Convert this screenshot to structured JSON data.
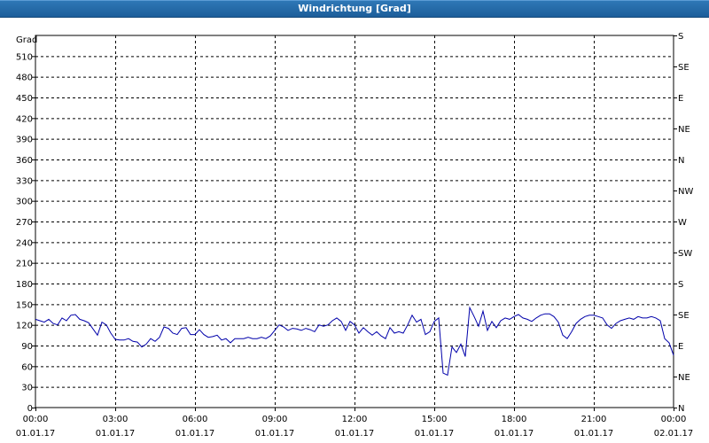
{
  "window": {
    "title": "Windrichtung [Grad]"
  },
  "colors": {
    "series": "#0000aa",
    "grid": "#000000",
    "title_bar": "#2468a8"
  },
  "chart_data": {
    "type": "line",
    "title": "Windrichtung [Grad]",
    "ylabel": "Grad",
    "xlabel": "",
    "ylim": [
      0,
      540
    ],
    "y_ticks": [
      0,
      30,
      60,
      90,
      120,
      150,
      180,
      210,
      240,
      270,
      300,
      330,
      360,
      390,
      420,
      450,
      480,
      510
    ],
    "y2_ticks": [
      {
        "value": 0,
        "label": "N"
      },
      {
        "value": 45,
        "label": "NE"
      },
      {
        "value": 90,
        "label": "E"
      },
      {
        "value": 135,
        "label": "SE"
      },
      {
        "value": 180,
        "label": "S"
      },
      {
        "value": 225,
        "label": "SW"
      },
      {
        "value": 270,
        "label": "W"
      },
      {
        "value": 315,
        "label": "NW"
      },
      {
        "value": 360,
        "label": "N"
      },
      {
        "value": 405,
        "label": "NE"
      },
      {
        "value": 450,
        "label": "E"
      },
      {
        "value": 495,
        "label": "SE"
      },
      {
        "value": 540,
        "label": "S"
      }
    ],
    "x_range": [
      "01.01.17 00:00",
      "02.01.17 00:00"
    ],
    "x_ticks": [
      {
        "time": "00:00",
        "date": "01.01.17"
      },
      {
        "time": "03:00",
        "date": "01.01.17"
      },
      {
        "time": "06:00",
        "date": "01.01.17"
      },
      {
        "time": "09:00",
        "date": "01.01.17"
      },
      {
        "time": "12:00",
        "date": "01.01.17"
      },
      {
        "time": "15:00",
        "date": "01.01.17"
      },
      {
        "time": "18:00",
        "date": "01.01.17"
      },
      {
        "time": "21:00",
        "date": "01.01.17"
      },
      {
        "time": "00:00",
        "date": "02.01.17"
      }
    ],
    "grid": true,
    "series": [
      {
        "time": [
          "00:00",
          "00:10",
          "00:20",
          "00:30",
          "00:40",
          "00:50",
          "01:00",
          "01:10",
          "01:20",
          "01:30",
          "01:40",
          "01:50",
          "02:00",
          "02:10",
          "02:20",
          "02:30",
          "02:40",
          "02:50",
          "03:00",
          "03:10",
          "03:20",
          "03:30",
          "03:40",
          "03:50",
          "04:00",
          "04:10",
          "04:20",
          "04:30",
          "04:40",
          "04:50",
          "05:00",
          "05:10",
          "05:20",
          "05:30",
          "05:40",
          "05:50",
          "06:00",
          "06:10",
          "06:20",
          "06:30",
          "06:40",
          "06:50",
          "07:00",
          "07:10",
          "07:20",
          "07:30",
          "07:40",
          "07:50",
          "08:00",
          "08:10",
          "08:20",
          "08:30",
          "08:40",
          "08:50",
          "09:00",
          "09:10",
          "09:20",
          "09:30",
          "09:40",
          "09:50",
          "10:00",
          "10:10",
          "10:20",
          "10:30",
          "10:40",
          "10:50",
          "11:00",
          "11:10",
          "11:20",
          "11:30",
          "11:40",
          "11:50",
          "12:00",
          "12:10",
          "12:20",
          "12:30",
          "12:40",
          "12:50",
          "13:00",
          "13:10",
          "13:20",
          "13:30",
          "13:40",
          "13:50",
          "14:00",
          "14:10",
          "14:20",
          "14:30",
          "14:40",
          "14:50",
          "15:00",
          "15:10",
          "15:20",
          "15:30",
          "15:40",
          "15:50",
          "16:00",
          "16:10",
          "16:20",
          "16:30",
          "16:40",
          "16:50",
          "17:00",
          "17:10",
          "17:20",
          "17:30",
          "17:40",
          "17:50",
          "18:00",
          "18:10",
          "18:20",
          "18:30",
          "18:40",
          "18:50",
          "19:00",
          "19:10",
          "19:20",
          "19:30",
          "19:40",
          "19:50",
          "20:00",
          "20:10",
          "20:20",
          "20:30",
          "20:40",
          "20:50",
          "21:00",
          "21:10",
          "21:20",
          "21:30",
          "21:40",
          "21:50",
          "22:00",
          "22:10",
          "22:20",
          "22:30",
          "22:40",
          "22:50",
          "23:00",
          "23:10",
          "23:20",
          "23:30",
          "23:40",
          "23:50",
          "00:00"
        ],
        "values": [
          128,
          126,
          124,
          128,
          122,
          120,
          130,
          126,
          134,
          135,
          128,
          126,
          123,
          114,
          105,
          124,
          120,
          108,
          99,
          98,
          98,
          100,
          96,
          95,
          88,
          92,
          100,
          96,
          102,
          117,
          115,
          108,
          106,
          115,
          116,
          106,
          106,
          113,
          106,
          102,
          103,
          105,
          98,
          100,
          94,
          100,
          100,
          100,
          102,
          100,
          100,
          102,
          100,
          104,
          112,
          120,
          117,
          112,
          115,
          114,
          112,
          115,
          113,
          110,
          120,
          118,
          120,
          126,
          130,
          125,
          112,
          125,
          120,
          108,
          116,
          110,
          105,
          110,
          104,
          100,
          116,
          108,
          110,
          108,
          120,
          134,
          124,
          128,
          106,
          110,
          125,
          130,
          50,
          47,
          88,
          80,
          92,
          74,
          145,
          132,
          118,
          140,
          112,
          125,
          116,
          126,
          130,
          128,
          132,
          135,
          130,
          128,
          125,
          130,
          134,
          136,
          136,
          132,
          124,
          105,
          100,
          110,
          122,
          128,
          132,
          134,
          134,
          132,
          130,
          120,
          115,
          122,
          126,
          128,
          130,
          128,
          132,
          130,
          130,
          132,
          130,
          126,
          100,
          94,
          76
        ]
      }
    ]
  }
}
